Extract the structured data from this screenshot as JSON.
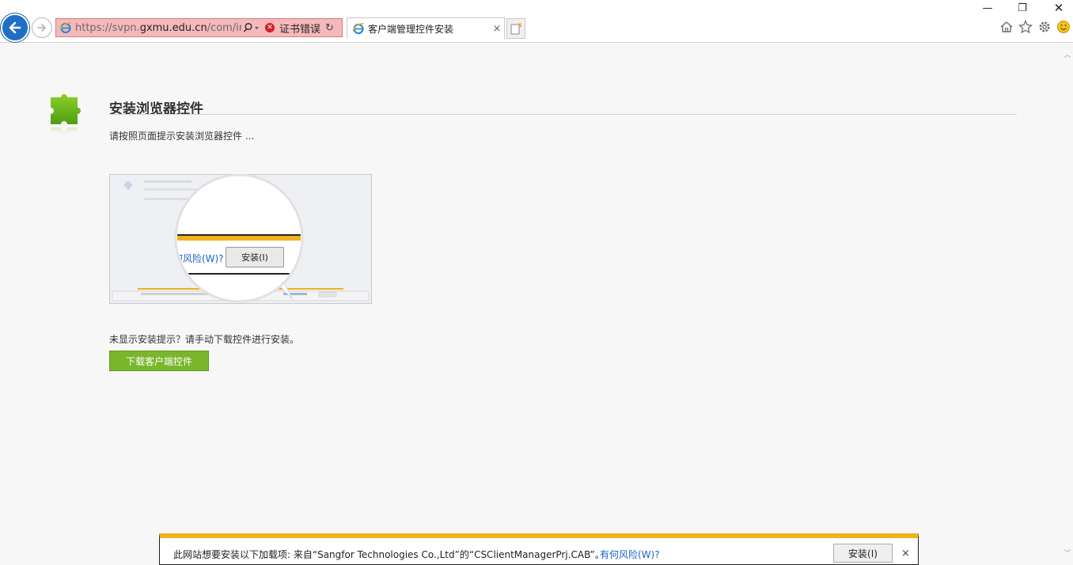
{
  "window": {
    "minimize": "—",
    "restore": "❐",
    "close": "✕"
  },
  "address_bar": {
    "url_prefix": "https://svpn.",
    "url_host": "gxmu.edu.cn",
    "url_suffix": "/com/instal",
    "cert_error": "证书错误"
  },
  "tab": {
    "title": "客户端管理控件安装",
    "close": "×"
  },
  "page": {
    "heading": "安装浏览器控件",
    "subtext": "请按照页面提示安装浏览器控件 ...",
    "illustration": {
      "risk_text": "何风险(W)?",
      "install_label": "安装(I)"
    },
    "no_prompt_text": "未显示安装提示？请手动下载控件进行安装。",
    "download_button": "下载客户端控件"
  },
  "infobar": {
    "message": "此网站想要安装以下加载项: 来自“Sangfor Technologies Co.,Ltd”的“CSClientManagerPrj.CAB”。",
    "risk_link": "有何风险(W)?",
    "install_button": "安装(I)",
    "close": "×"
  },
  "colors": {
    "back_button": "#1f6fc5",
    "address_error_bg": "#f5b9bb",
    "download_button": "#7ab62c",
    "infobar_accent": "#f1b11b",
    "link": "#1a64c4"
  },
  "icons": [
    "back-arrow-icon",
    "forward-arrow-icon",
    "ie-logo-icon",
    "search-icon",
    "cert-error-icon",
    "refresh-icon",
    "new-tab-icon",
    "home-icon",
    "favorites-star-icon",
    "gear-icon",
    "smiley-feedback-icon",
    "puzzle-icon"
  ]
}
